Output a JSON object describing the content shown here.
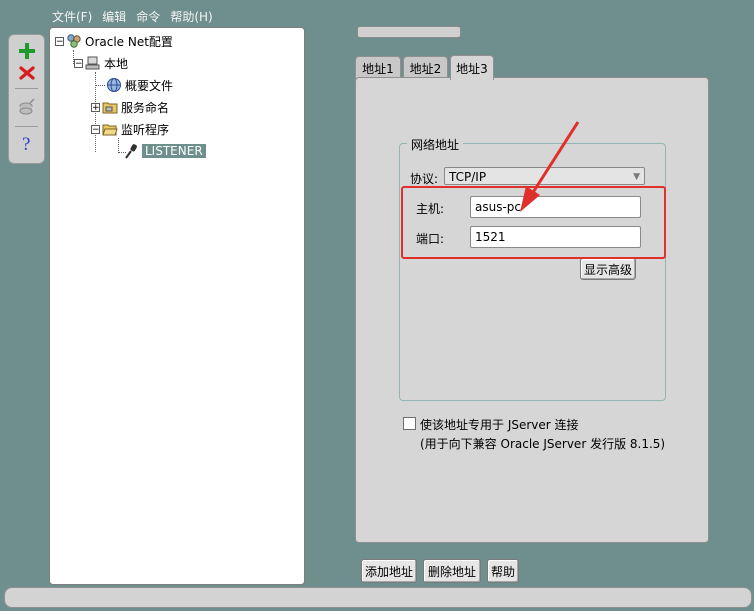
{
  "menubar": {
    "file": "文件(F)",
    "edit": "编辑",
    "command": "命令",
    "help": "帮助(H)"
  },
  "tree": {
    "root": "Oracle Net配置",
    "local": "本地",
    "profile": "概要文件",
    "service_naming": "服务命名",
    "listeners": "监听程序",
    "listener": "LISTENER"
  },
  "tabs": [
    "地址1",
    "地址2",
    "地址3"
  ],
  "address_group": {
    "title": "网络地址",
    "protocol_label": "协议:",
    "protocol_value": "TCP/IP",
    "host_label": "主机:",
    "host_value": "asus-pc",
    "port_label": "端口:",
    "port_value": "1521",
    "advanced_button": "显示高级"
  },
  "jserver": {
    "checkbox_label": "使该地址专用于 JServer 连接",
    "note": "(用于向下兼容 Oracle JServer 发行版 8.1.5)",
    "checked": false
  },
  "bottom_buttons": {
    "add": "添加地址",
    "delete": "删除地址",
    "help": "帮助"
  },
  "colors": {
    "background": "#6f8f8e",
    "selection": "#6d8f8d",
    "highlight_annotation": "#e0302c"
  },
  "icons": {
    "add": "green-plus-icon",
    "delete": "red-x-icon",
    "test": "test-service-icon",
    "help": "question-icon",
    "annotation": "red-arrow"
  }
}
